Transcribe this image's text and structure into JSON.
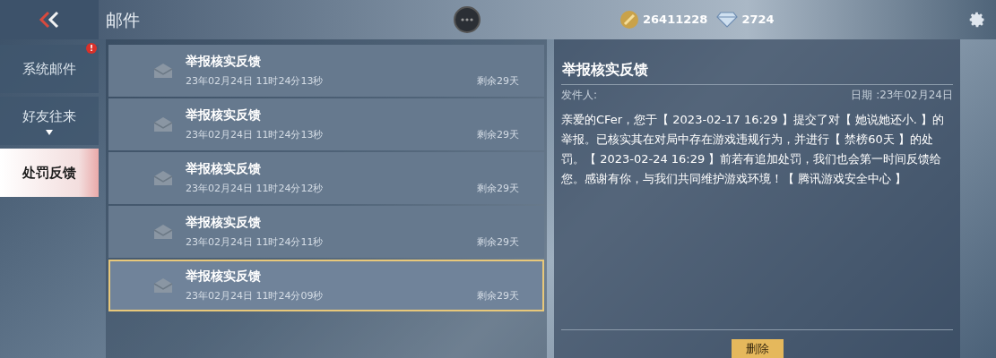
{
  "header": {
    "title": "邮件",
    "coins": "26411228",
    "diamonds": "2724"
  },
  "sidebar": {
    "items": [
      {
        "label": "系统邮件",
        "selected": false,
        "badge": "!",
        "expandable": false
      },
      {
        "label": "好友往来",
        "selected": false,
        "expandable": true
      },
      {
        "label": "处罚反馈",
        "selected": true,
        "expandable": false
      }
    ]
  },
  "mails": [
    {
      "title": "举报核实反馈",
      "date": "23年02月24日 11时24分13秒",
      "remaining": "剩余29天",
      "selected": false
    },
    {
      "title": "举报核实反馈",
      "date": "23年02月24日 11时24分13秒",
      "remaining": "剩余29天",
      "selected": false
    },
    {
      "title": "举报核实反馈",
      "date": "23年02月24日 11时24分12秒",
      "remaining": "剩余29天",
      "selected": false
    },
    {
      "title": "举报核实反馈",
      "date": "23年02月24日 11时24分11秒",
      "remaining": "剩余29天",
      "selected": false
    },
    {
      "title": "举报核实反馈",
      "date": "23年02月24日 11时24分09秒",
      "remaining": "剩余29天",
      "selected": true
    }
  ],
  "detail": {
    "title": "举报核实反馈",
    "sender_label": "发件人:",
    "date": "日期 :23年02月24日",
    "body": "亲爱的CFer，您于【 2023-02-17 16:29 】提交了对【 她说她还小. 】的举报。已核实其在对局中存在游戏违规行为，并进行【 禁榜60天 】的处罚。【 2023-02-24 16:29 】前若有追加处罚，我们也会第一时间反馈给您。感谢有你，与我们共同维护游戏环境！【 腾讯游戏安全中心 】",
    "button": "删除"
  }
}
